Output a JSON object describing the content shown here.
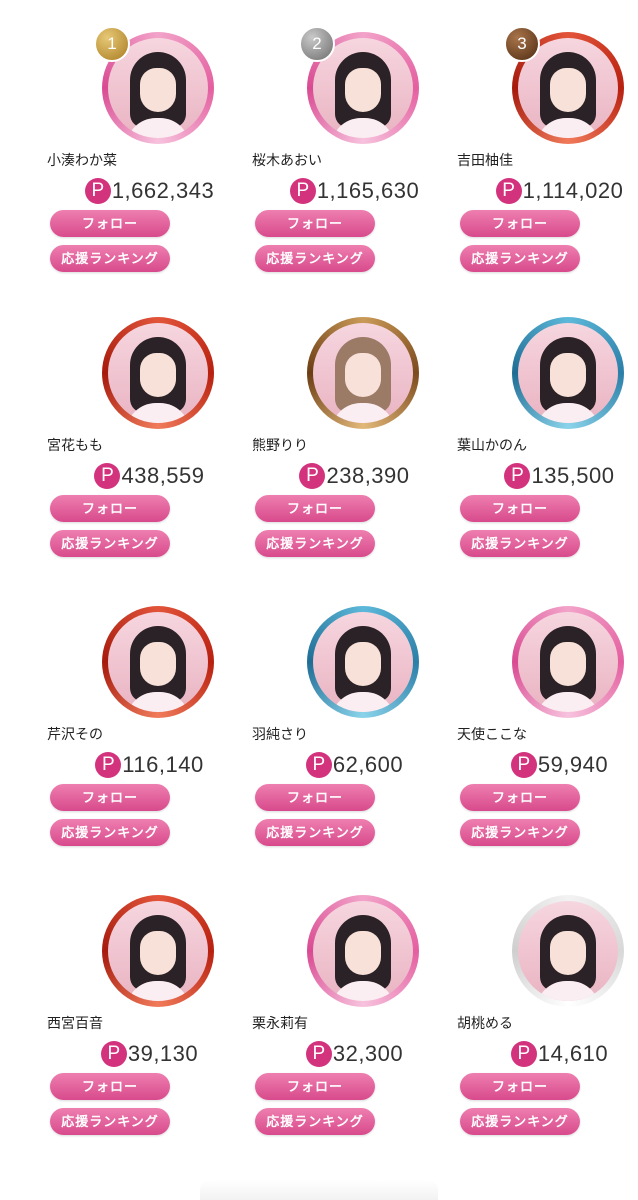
{
  "follow_label": "フォロー",
  "ranking_label": "応援ランキング",
  "point_icon": "P",
  "accent_color": "#d84a8c",
  "members": [
    {
      "rank": "1",
      "name": "小湊わか菜",
      "points": "1,662,343",
      "ring": "pink"
    },
    {
      "rank": "2",
      "name": "桜木あおい",
      "points": "1,165,630",
      "ring": "pink"
    },
    {
      "rank": "3",
      "name": "吉田柚佳",
      "points": "1,114,020",
      "ring": "red"
    },
    {
      "rank": "",
      "name": "宮花もも",
      "points": "438,559",
      "ring": "red"
    },
    {
      "rank": "",
      "name": "熊野りり",
      "points": "238,390",
      "ring": "bronze"
    },
    {
      "rank": "",
      "name": "葉山かのん",
      "points": "135,500",
      "ring": "blue"
    },
    {
      "rank": "",
      "name": "芹沢その",
      "points": "116,140",
      "ring": "red"
    },
    {
      "rank": "",
      "name": "羽純さり",
      "points": "62,600",
      "ring": "blue"
    },
    {
      "rank": "",
      "name": "天使ここな",
      "points": "59,940",
      "ring": "pink"
    },
    {
      "rank": "",
      "name": "西宮百音",
      "points": "39,130",
      "ring": "red"
    },
    {
      "rank": "",
      "name": "栗永莉有",
      "points": "32,300",
      "ring": "pink"
    },
    {
      "rank": "",
      "name": "胡桃める",
      "points": "14,610",
      "ring": "white"
    }
  ]
}
